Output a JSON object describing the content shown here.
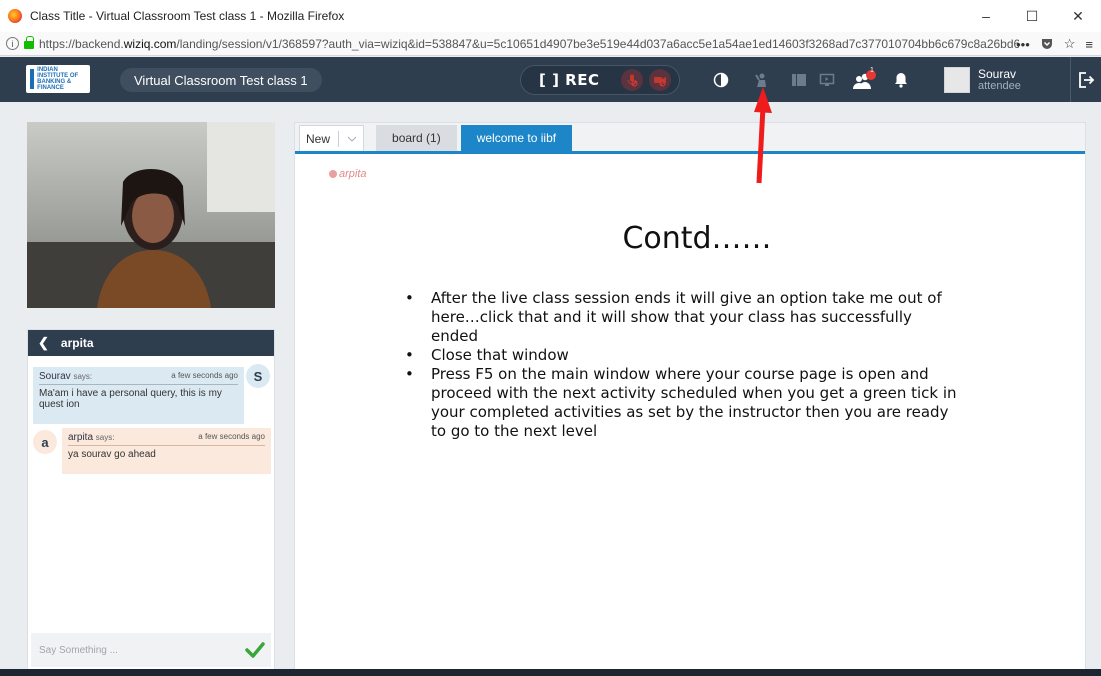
{
  "browser": {
    "window_title": "Class Title - Virtual Classroom Test class 1 - Mozilla Firefox",
    "url_prefix": "https://backend.",
    "url_domain": "wiziq.com",
    "url_rest": "/landing/session/v1/368597?auth_via=wiziq&id=538847&u=5c10651d4907be3e519e44d037a6acc5e1a54ae1ed14603f3268ad7c377010704bb6c679c8a26bd69aaed94d45c",
    "page_actions_label": "•••"
  },
  "header": {
    "logo_text": "INDIAN INSTITUTE OF BANKING & FINANCE",
    "class_title": "Virtual Classroom Test class 1",
    "rec_label": "[ ] REC",
    "notification_count": "1",
    "user": {
      "name": "Sourav",
      "role": "attendee"
    }
  },
  "chat": {
    "title": "arpita",
    "messages": [
      {
        "sender": "Sourav",
        "says": "says:",
        "time": "a few seconds ago",
        "text": "Ma'am i have a personal query, this is my quest ion",
        "avatar": "S"
      },
      {
        "sender": "arpita",
        "says": "says:",
        "time": "a few seconds ago",
        "text": "ya sourav go ahead",
        "avatar": "a"
      }
    ],
    "input_placeholder": "Say Something ..."
  },
  "board": {
    "tabs": {
      "new_label": "New",
      "board_label": "board (1)",
      "active_label": "welcome to iibf"
    },
    "presenter": "arpita",
    "slide_title": "Contd……",
    "bullets": [
      "After the live class session ends it will give an option take me out of here…click that and it will show that your class has successfully ended",
      "Close that window",
      "Press F5 on the main window where your course page is open and proceed with the next activity scheduled when you get a green tick in your completed activities as set by the instructor then you are ready to go to the next level"
    ]
  },
  "colors": {
    "header_bg": "#2f3e4f",
    "tab_active": "#1c86c8",
    "arrow": "#ee1c1c",
    "send_check": "#3aa63a"
  }
}
